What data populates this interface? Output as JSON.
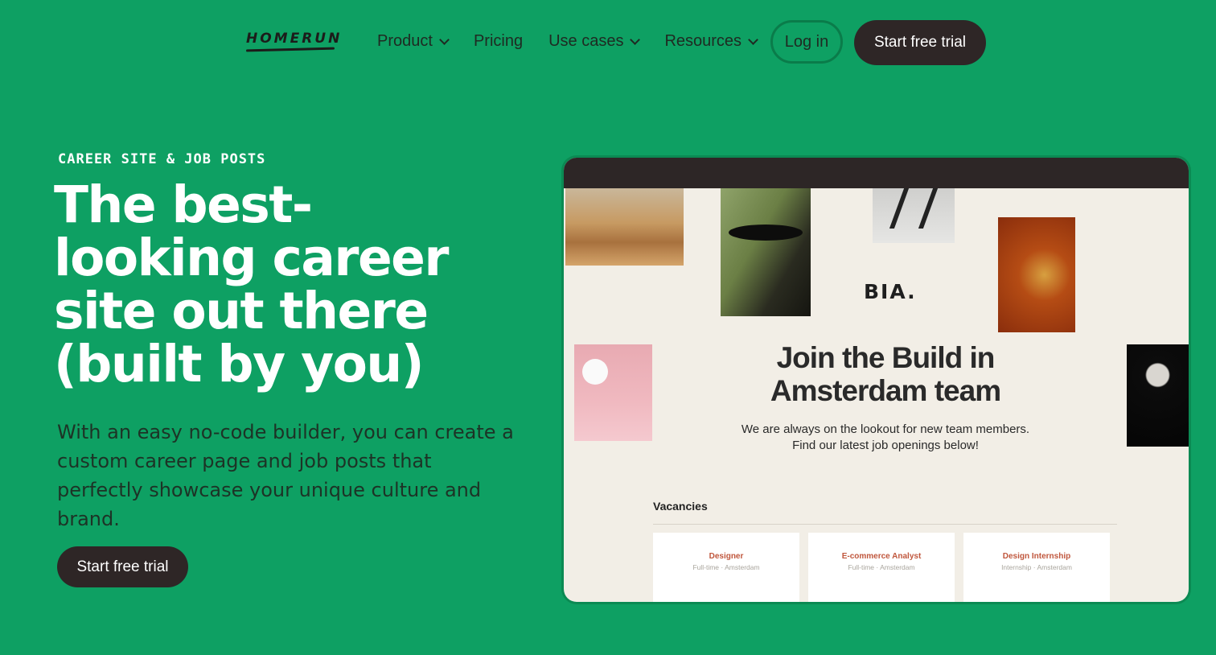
{
  "nav": {
    "logo": "HOMERUN",
    "items": [
      {
        "label": "Product",
        "dropdown": true
      },
      {
        "label": "Pricing",
        "dropdown": false
      },
      {
        "label": "Use cases",
        "dropdown": true
      },
      {
        "label": "Resources",
        "dropdown": true
      }
    ],
    "login_label": "Log in",
    "trial_label": "Start free trial"
  },
  "hero": {
    "eyebrow": "CAREER SITE & JOB POSTS",
    "headline": "The best-looking career site out there (built by you)",
    "subtext": "With an easy no-code builder, you can create a custom career page and job posts that perfectly showcase your unique culture and brand.",
    "cta_label": "Start free trial"
  },
  "preview": {
    "brand": "BIA.",
    "title": "Join the Build in Amsterdam team",
    "subtitle_line1": "We are always on the lookout for new team members.",
    "subtitle_line2": "Find our latest job openings below!",
    "vacancies_label": "Vacancies",
    "vacancies": [
      {
        "role": "Designer",
        "meta": "Full-time · Amsterdam"
      },
      {
        "role": "E-commerce Analyst",
        "meta": "Full-time · Amsterdam"
      },
      {
        "role": "Design Internship",
        "meta": "Internship · Amsterdam"
      }
    ]
  },
  "colors": {
    "background": "#0ea063",
    "dark_button": "#2e2626",
    "preview_bg": "#f2eee6",
    "vacancy_accent": "#c0573d"
  }
}
